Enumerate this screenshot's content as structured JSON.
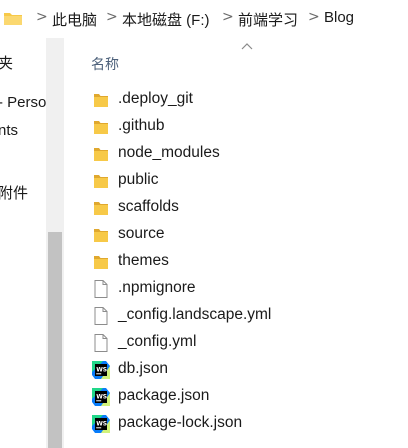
{
  "breadcrumb": {
    "items": [
      "此电脑",
      "本地磁盘 (F:)",
      "前端学习",
      "Blog"
    ],
    "separator": ">"
  },
  "navpane": {
    "items": [
      "夹",
      "- Perso",
      "nts",
      "附件"
    ]
  },
  "filelist": {
    "column_header": "名称",
    "sort_indicator": "ascending",
    "items": [
      {
        "name": ".deploy_git",
        "type": "folder"
      },
      {
        "name": ".github",
        "type": "folder"
      },
      {
        "name": "node_modules",
        "type": "folder"
      },
      {
        "name": "public",
        "type": "folder"
      },
      {
        "name": "scaffolds",
        "type": "folder"
      },
      {
        "name": "source",
        "type": "folder"
      },
      {
        "name": "themes",
        "type": "folder"
      },
      {
        "name": ".npmignore",
        "type": "file"
      },
      {
        "name": "_config.landscape.yml",
        "type": "file"
      },
      {
        "name": "_config.yml",
        "type": "file"
      },
      {
        "name": "db.json",
        "type": "webstorm-json"
      },
      {
        "name": "package.json",
        "type": "webstorm-json"
      },
      {
        "name": "package-lock.json",
        "type": "webstorm-json"
      }
    ]
  },
  "colors": {
    "folder": "#f7c948",
    "folder_dark": "#e0a82e",
    "header_text": "#4c607a",
    "webstorm_cyan": "#21d789",
    "webstorm_blue": "#087cfa"
  }
}
